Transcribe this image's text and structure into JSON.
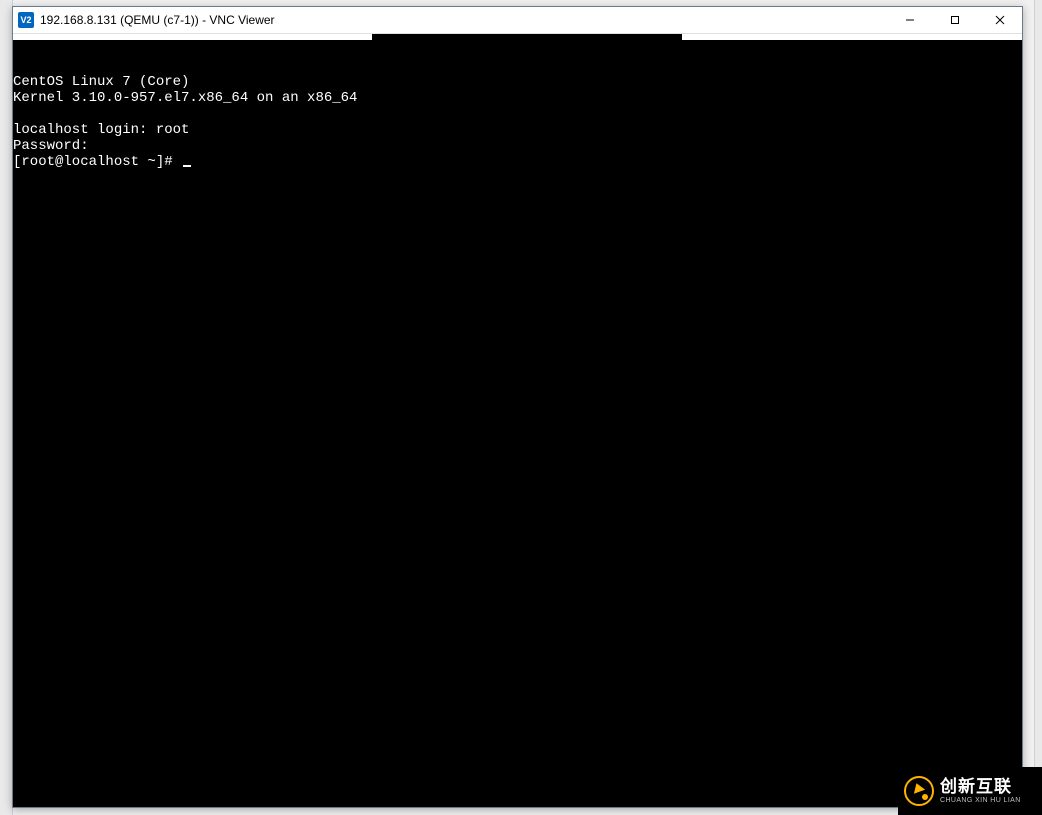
{
  "titlebar": {
    "icon_text": "V2",
    "title": "192.168.8.131 (QEMU (c7-1)) - VNC Viewer",
    "minimize": "—",
    "maximize": "□",
    "close": "✕"
  },
  "terminal": {
    "lines": [
      "CentOS Linux 7 (Core)",
      "Kernel 3.10.0-957.el7.x86_64 on an x86_64",
      "",
      "localhost login: root",
      "Password:",
      "[root@localhost ~]# "
    ]
  },
  "watermark": {
    "cn": "创新互联",
    "en": "CHUANG XIN HU LIAN"
  }
}
